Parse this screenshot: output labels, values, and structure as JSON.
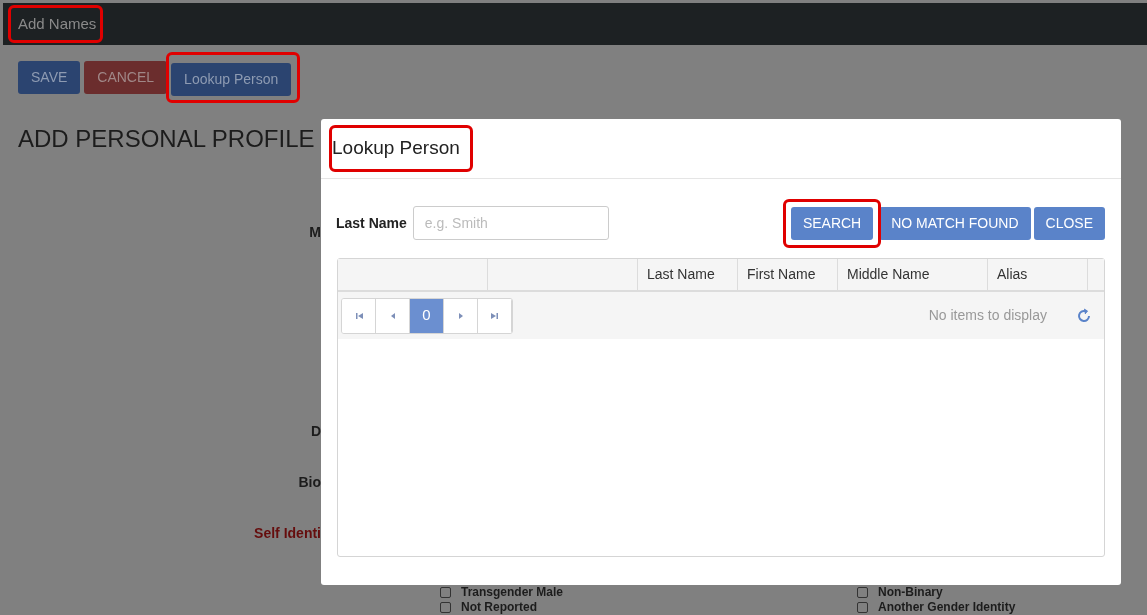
{
  "header": {
    "title": "Add Names"
  },
  "toolbar": [
    {
      "label": "SAVE",
      "kind": "primary"
    },
    {
      "label": "CANCEL",
      "kind": "danger"
    },
    {
      "label": "Lookup Person",
      "kind": "primary"
    }
  ],
  "page_title": "ADD PERSONAL PROFILE",
  "form_labels": [
    {
      "text": "M",
      "kind": "normal"
    },
    {
      "text": "D",
      "kind": "normal"
    },
    {
      "text": "Bio",
      "kind": "normal"
    },
    {
      "text": "Self Identi",
      "kind": "required"
    }
  ],
  "gender_options": [
    {
      "label": "Transgender Male",
      "checked": false
    },
    {
      "label": "Non-Binary",
      "checked": false
    },
    {
      "label": "Not Reported",
      "checked": false
    },
    {
      "label": "Another Gender Identity",
      "checked": false
    }
  ],
  "dialog": {
    "title": "Lookup Person",
    "search_label": "Last Name",
    "search_placeholder": "e.g. Smith",
    "buttons": [
      "SEARCH",
      "NO MATCH FOUND",
      "CLOSE"
    ],
    "grid": {
      "columns": [
        "",
        "",
        "Last Name",
        "First Name",
        "Middle Name",
        "Alias"
      ],
      "pages": [
        {
          "label": "0",
          "selected": true
        }
      ],
      "empty_message": "No items to display"
    }
  }
}
